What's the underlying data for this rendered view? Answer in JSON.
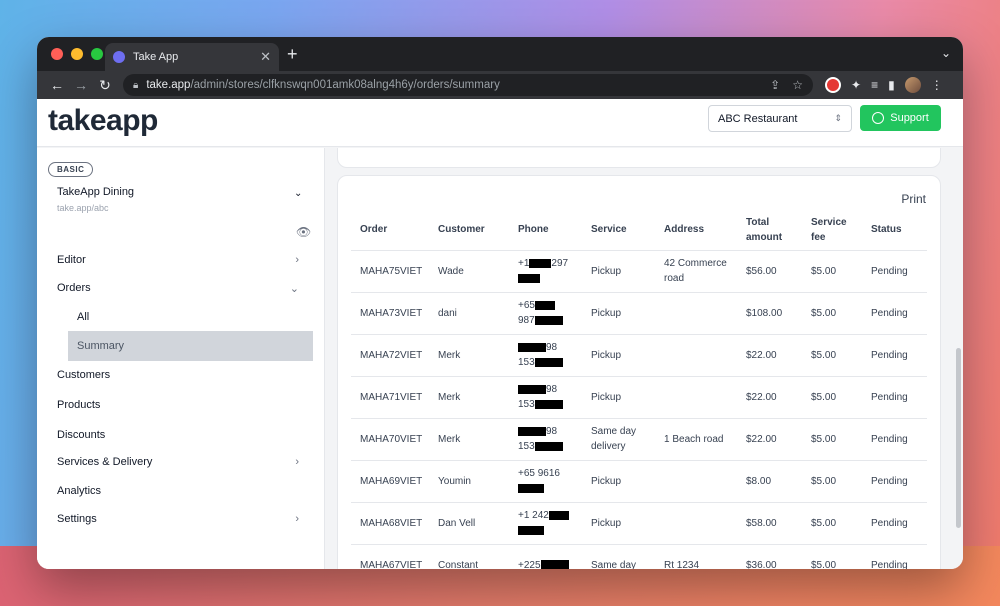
{
  "browser": {
    "tab_title": "Take App",
    "url_host": "take.app",
    "url_path": "/admin/stores/clfknswqn001amk08alng4h6y/orders/summary"
  },
  "header": {
    "logo": "takeapp",
    "store_select": "ABC Restaurant",
    "support_label": "Support"
  },
  "sidebar": {
    "plan_badge": "BASIC",
    "store_name": "TakeApp Dining",
    "store_url": "take.app/abc",
    "items": [
      {
        "label": "Editor"
      },
      {
        "label": "Orders"
      },
      {
        "label": "All"
      },
      {
        "label": "Summary"
      },
      {
        "label": "Customers"
      },
      {
        "label": "Products"
      },
      {
        "label": "Discounts"
      },
      {
        "label": "Services & Delivery"
      },
      {
        "label": "Analytics"
      },
      {
        "label": "Settings"
      }
    ]
  },
  "orders": {
    "print_label": "Print",
    "columns": [
      "Order",
      "Customer",
      "Phone",
      "Service",
      "Address",
      "Total amount",
      "Service fee",
      "Status"
    ],
    "rows": [
      {
        "order": "MAHA75VIET",
        "customer": "Wade",
        "phone1": "+1",
        "phone1b": "297",
        "service": "Pickup",
        "address": "42 Commerce road",
        "total": "$56.00",
        "fee": "$5.00",
        "status": "Pending"
      },
      {
        "order": "MAHA73VIET",
        "customer": "dani",
        "phone1": "+65",
        "phone1b": "",
        "phone2": "987",
        "service": "Pickup",
        "address": "",
        "total": "$108.00",
        "fee": "$5.00",
        "status": "Pending"
      },
      {
        "order": "MAHA72VIET",
        "customer": "Merk",
        "phone1": "",
        "phone1b": "98",
        "phone2": "153",
        "service": "Pickup",
        "address": "",
        "total": "$22.00",
        "fee": "$5.00",
        "status": "Pending"
      },
      {
        "order": "MAHA71VIET",
        "customer": "Merk",
        "phone1": "",
        "phone1b": "98",
        "phone2": "153",
        "service": "Pickup",
        "address": "",
        "total": "$22.00",
        "fee": "$5.00",
        "status": "Pending"
      },
      {
        "order": "MAHA70VIET",
        "customer": "Merk",
        "phone1": "",
        "phone1b": "98",
        "phone2": "153",
        "service": "Same day delivery",
        "address": "1 Beach road",
        "total": "$22.00",
        "fee": "$5.00",
        "status": "Pending"
      },
      {
        "order": "MAHA69VIET",
        "customer": "Youmin",
        "phone1": "+65 9616",
        "phone1b": "",
        "phone2": "",
        "service": "Pickup",
        "address": "",
        "total": "$8.00",
        "fee": "$5.00",
        "status": "Pending"
      },
      {
        "order": "MAHA68VIET",
        "customer": "Dan Vell",
        "phone1": "+1 242",
        "phone1b": "",
        "phone2": "",
        "service": "Pickup",
        "address": "",
        "total": "$58.00",
        "fee": "$5.00",
        "status": "Pending"
      },
      {
        "order": "MAHA67VIET",
        "customer": "Constant",
        "phone1": "+225",
        "phone1b": "",
        "phone2": "",
        "service": "Same day",
        "address": "Rt 1234",
        "total": "$36.00",
        "fee": "$5.00",
        "status": "Pending"
      }
    ]
  }
}
